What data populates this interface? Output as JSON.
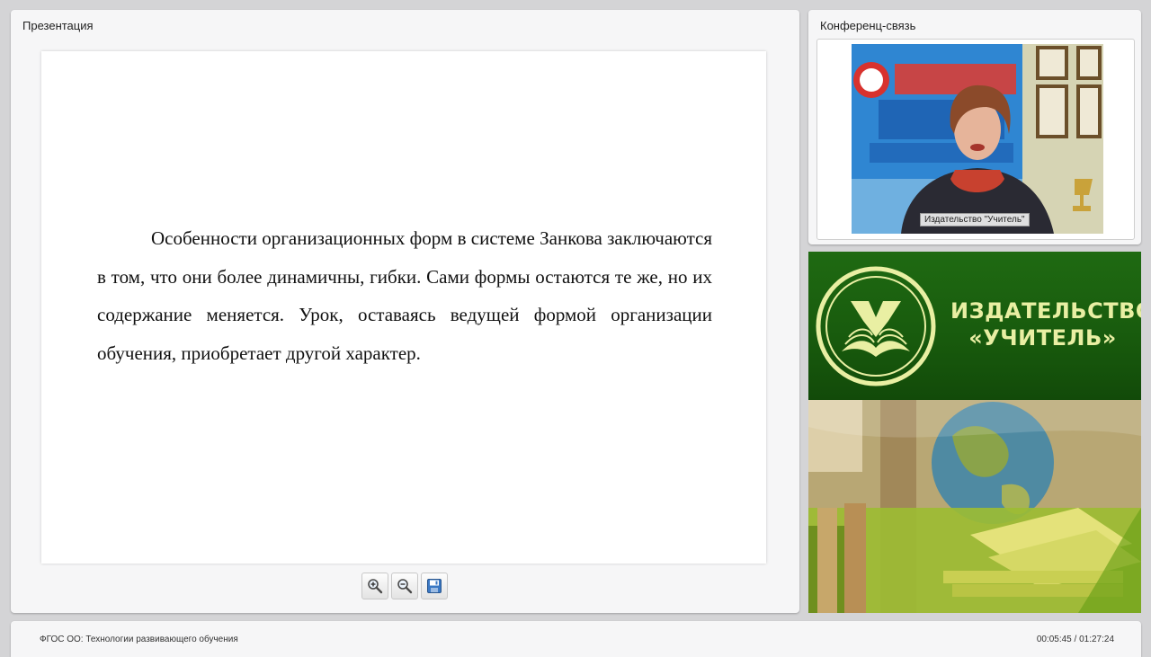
{
  "presentation": {
    "title": "Презентация",
    "slide_text": "Особенности организационных форм в системе Занкова заключаются в том, что они более динамичны, гибки. Сами формы остаются те же, но их содержание меняется. Урок, оставаясь ведущей формой организации обучения, приобретает другой характер."
  },
  "toolbar": {
    "buttons": [
      {
        "icon": "zoom-in-icon"
      },
      {
        "icon": "zoom-out-icon"
      },
      {
        "icon": "save-icon"
      }
    ]
  },
  "conference": {
    "title": "Конференц-связь",
    "video_label": "Издательство \"Учитель\""
  },
  "ad": {
    "title": "ИЗДАТЕЛЬСТВО\n«УЧИТЕЛЬ»"
  },
  "footer": {
    "course_title": "ФГОС ОО: Технологии развивающего обучения",
    "time": "00:05:45 / 01:27:24"
  },
  "colors": {
    "background": "#d4d4d6",
    "panel": "#f6f6f7",
    "ad_green": "#1f6a12",
    "ad_text": "#e9efa3"
  }
}
